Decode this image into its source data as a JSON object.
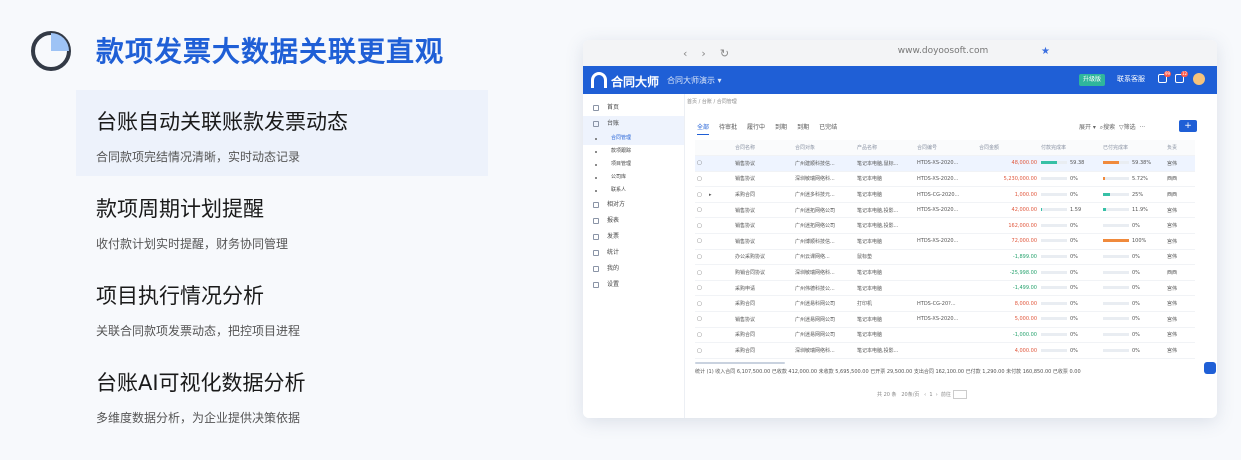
{
  "headline": "款项发票大数据关联更直观",
  "features": [
    {
      "title": "台账自动关联账款发票动态",
      "subtitle": "合同款项完结情况清晰，实时动态记录",
      "active": true
    },
    {
      "title": "款项周期计划提醒",
      "subtitle": "收付款计划实时提醒，财务协同管理",
      "active": false
    },
    {
      "title": "项目执行情况分析",
      "subtitle": "关联合同款项发票动态，把控项目进程",
      "active": false
    },
    {
      "title": "台账AI可视化数据分析",
      "subtitle": "多维度数据分析，为企业提供决策依据",
      "active": false
    }
  ],
  "browser": {
    "back": "‹",
    "forward": "›",
    "reload": "↻",
    "url": "www.doyoosoft.com",
    "star": "★"
  },
  "app": {
    "name": "合同大师",
    "tenant": "合同大师演示 ▾",
    "upgrade": "升级版",
    "service": "联系客服",
    "badge1": "99",
    "badge2": "12"
  },
  "sidebar": {
    "items": [
      {
        "label": "首页",
        "sub": false,
        "active": false
      },
      {
        "label": "台账",
        "sub": false,
        "active": true
      },
      {
        "label": "合同管理",
        "sub": true,
        "active": true
      },
      {
        "label": "款项跟踪",
        "sub": true,
        "active": false
      },
      {
        "label": "项目管理",
        "sub": true,
        "active": false
      },
      {
        "label": "公司库",
        "sub": true,
        "active": false
      },
      {
        "label": "联系人",
        "sub": true,
        "active": false
      },
      {
        "label": "相对方",
        "sub": false,
        "active": false
      },
      {
        "label": "报表",
        "sub": false,
        "active": false
      },
      {
        "label": "发票",
        "sub": false,
        "active": false
      },
      {
        "label": "统计",
        "sub": false,
        "active": false
      },
      {
        "label": "我的",
        "sub": false,
        "active": false
      },
      {
        "label": "设置",
        "sub": false,
        "active": false
      }
    ]
  },
  "breadcrumb": "首页 / 台账 / 合同管理",
  "tabs": [
    "全部",
    "待审批",
    "履行中",
    "到期",
    "到期",
    "已完结"
  ],
  "controls": {
    "fold": "展开 ▾",
    "search": "搜索",
    "filter": "筛选",
    "add": "+"
  },
  "table": {
    "headers": [
      "",
      "",
      "合同名称",
      "合同对象",
      "产品名称",
      "合同编号",
      "合同金额",
      "付款完成率",
      "已付完成率",
      "负责"
    ],
    "rows": [
      {
        "name": "销售协议",
        "party": "广州建顺科技信...",
        "product": "笔记本电脑,鼠标...",
        "code": "HTDS-XS-2020...",
        "amount": "48,000.00",
        "neg": false,
        "p1": "59.38",
        "f1": 0.6,
        "c1": "#36c0a6",
        "p2": "59.38%",
        "f2": 0.6,
        "c2": "#f08a3c",
        "owner": "宫伟"
      },
      {
        "name": "销售协议",
        "party": "深圳敏瑞网络科...",
        "product": "笔记本电脑",
        "code": "HTDS-XS-2020...",
        "amount": "5,230,000.00",
        "neg": false,
        "p1": "0%",
        "f1": 0,
        "c1": "#36c0a6",
        "p2": "5.72%",
        "f2": 0.06,
        "c2": "#f08a3c",
        "owner": "西西"
      },
      {
        "name": "采购合同",
        "party": "广州迷多科技元...",
        "product": "笔记本电脑",
        "code": "HTDS-CG-2020...",
        "amount": "1,000.00",
        "neg": false,
        "p1": "0%",
        "f1": 0,
        "c1": "#36c0a6",
        "p2": "25%",
        "f2": 0.25,
        "c2": "#36c0a6",
        "owner": "西西"
      },
      {
        "name": "销售协议",
        "party": "广州迷拓网络公司",
        "product": "笔记本电脑,投影...",
        "code": "HTDS-XS-2020...",
        "amount": "42,000.00",
        "neg": false,
        "p1": "1.59",
        "f1": 0.02,
        "c1": "#36c0a6",
        "p2": "11.9%",
        "f2": 0.12,
        "c2": "#36c0a6",
        "owner": "宫伟"
      },
      {
        "name": "销售协议",
        "party": "广州迷拓网络公司",
        "product": "笔记本电脑,投影...",
        "code": "",
        "amount": "162,000.00",
        "neg": false,
        "p1": "0%",
        "f1": 0,
        "c1": "#36c0a6",
        "p2": "0%",
        "f2": 0,
        "c2": "#36c0a6",
        "owner": "宫伟"
      },
      {
        "name": "销售协议",
        "party": "广州博顺科技信...",
        "product": "笔记本电脑",
        "code": "HTDS-XS-2020...",
        "amount": "72,000.00",
        "neg": false,
        "p1": "0%",
        "f1": 0,
        "c1": "#36c0a6",
        "p2": "100%",
        "f2": 1,
        "c2": "#f08a3c",
        "owner": "宫伟"
      },
      {
        "name": "办公采购协议",
        "party": "广州云课网络...",
        "product": "鼠标垫",
        "code": "",
        "amount": "-1,899.00",
        "neg": true,
        "p1": "0%",
        "f1": 0,
        "c1": "#36c0a6",
        "p2": "0%",
        "f2": 0,
        "c2": "#36c0a6",
        "owner": "宫伟"
      },
      {
        "name": "购销合同协议",
        "party": "深圳敏瑞网络科...",
        "product": "笔记本电脑",
        "code": "",
        "amount": "-25,998.00",
        "neg": true,
        "p1": "0%",
        "f1": 0,
        "c1": "#36c0a6",
        "p2": "0%",
        "f2": 0,
        "c2": "#36c0a6",
        "owner": "西西"
      },
      {
        "name": "采购申请",
        "party": "广州伟德科技公...",
        "product": "笔记本电脑",
        "code": "",
        "amount": "-1,499.00",
        "neg": true,
        "p1": "0%",
        "f1": 0,
        "c1": "#36c0a6",
        "p2": "0%",
        "f2": 0,
        "c2": "#36c0a6",
        "owner": "宫伟"
      },
      {
        "name": "采购合同",
        "party": "广州迷易科网公司",
        "product": "打印机",
        "code": "HTDS-CG-20?...",
        "amount": "8,000.00",
        "neg": false,
        "p1": "0%",
        "f1": 0,
        "c1": "#36c0a6",
        "p2": "0%",
        "f2": 0,
        "c2": "#36c0a6",
        "owner": "宫伟"
      },
      {
        "name": "销售协议",
        "party": "广州迷易网网公司",
        "product": "笔记本电脑",
        "code": "HTDS-XS-2020...",
        "amount": "5,000.00",
        "neg": false,
        "p1": "0%",
        "f1": 0,
        "c1": "#36c0a6",
        "p2": "0%",
        "f2": 0,
        "c2": "#36c0a6",
        "owner": "宫伟"
      },
      {
        "name": "采购合同",
        "party": "广州迷易网网公司",
        "product": "笔记本电脑",
        "code": "",
        "amount": "-1,000.00",
        "neg": true,
        "p1": "0%",
        "f1": 0,
        "c1": "#36c0a6",
        "p2": "0%",
        "f2": 0,
        "c2": "#36c0a6",
        "owner": "宫伟"
      },
      {
        "name": "采购合同",
        "party": "深圳敏瑞网络科...",
        "product": "笔记本电脑,投影...",
        "code": "",
        "amount": "4,000.00",
        "neg": false,
        "p1": "0%",
        "f1": 0,
        "c1": "#36c0a6",
        "p2": "0%",
        "f2": 0,
        "c2": "#36c0a6",
        "owner": "宫伟"
      }
    ]
  },
  "summary": "统计 (1)    收入合同 6,107,500.00    已收款 412,000.00    未收款 5,695,500.00    已开票 29,500.00        支出合同 162,100.00    已付款 1,290.00    未付款 160,850.00    已收票 0.00",
  "pager": {
    "total": "共 20 条",
    "size": "20条/页",
    "page": "1",
    "goto": "前往"
  }
}
